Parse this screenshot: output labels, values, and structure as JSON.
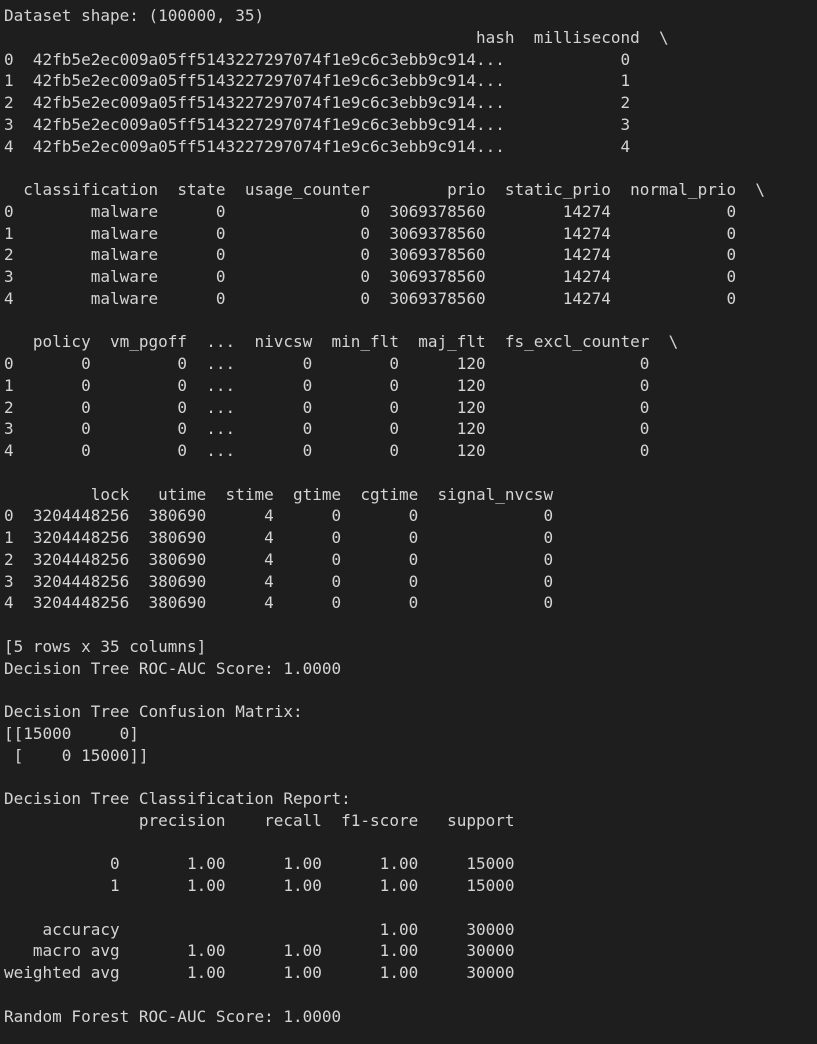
{
  "console_output": {
    "lines": [
      "Dataset shape: (100000, 35)",
      "                                                 hash  millisecond  \\",
      "0  42fb5e2ec009a05ff5143227297074f1e9c6c3ebb9c914...            0   ",
      "1  42fb5e2ec009a05ff5143227297074f1e9c6c3ebb9c914...            1   ",
      "2  42fb5e2ec009a05ff5143227297074f1e9c6c3ebb9c914...            2   ",
      "3  42fb5e2ec009a05ff5143227297074f1e9c6c3ebb9c914...            3   ",
      "4  42fb5e2ec009a05ff5143227297074f1e9c6c3ebb9c914...            4   ",
      "",
      "  classification  state  usage_counter        prio  static_prio  normal_prio  \\",
      "0        malware      0              0  3069378560        14274            0   ",
      "1        malware      0              0  3069378560        14274            0   ",
      "2        malware      0              0  3069378560        14274            0   ",
      "3        malware      0              0  3069378560        14274            0   ",
      "4        malware      0              0  3069378560        14274            0   ",
      "",
      "   policy  vm_pgoff  ...  nivcsw  min_flt  maj_flt  fs_excl_counter  \\",
      "0       0         0  ...       0        0      120                0   ",
      "1       0         0  ...       0        0      120                0   ",
      "2       0         0  ...       0        0      120                0   ",
      "3       0         0  ...       0        0      120                0   ",
      "4       0         0  ...       0        0      120                0   ",
      "",
      "         lock   utime  stime  gtime  cgtime  signal_nvcsw  ",
      "0  3204448256  380690      4      0       0             0  ",
      "1  3204448256  380690      4      0       0             0  ",
      "2  3204448256  380690      4      0       0             0  ",
      "3  3204448256  380690      4      0       0             0  ",
      "4  3204448256  380690      4      0       0             0  ",
      "",
      "[5 rows x 35 columns]",
      "Decision Tree ROC-AUC Score: 1.0000",
      "",
      "Decision Tree Confusion Matrix:",
      "[[15000     0]",
      " [    0 15000]]",
      "",
      "Decision Tree Classification Report:",
      "              precision    recall  f1-score   support",
      "",
      "           0       1.00      1.00      1.00     15000",
      "           1       1.00      1.00      1.00     15000",
      "",
      "    accuracy                           1.00     30000",
      "   macro avg       1.00      1.00      1.00     30000",
      "weighted avg       1.00      1.00      1.00     30000",
      "",
      "Random Forest ROC-AUC Score: 1.0000"
    ]
  }
}
